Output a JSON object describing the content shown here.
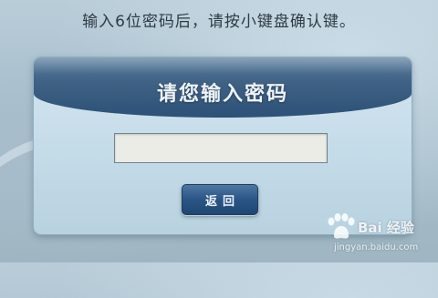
{
  "instruction": "输入6位密码后，请按小键盘确认键。",
  "dialog": {
    "title": "请您输入密码",
    "password_value": "",
    "back_label": "返回"
  },
  "watermark": {
    "brand": "Bai 经验",
    "url": "jingyan.baidu.com"
  },
  "colors": {
    "header_blue": "#2d5177",
    "dialog_bg": "#c4dbe8",
    "button_blue": "#2b5586",
    "input_bg": "#ecece6"
  }
}
